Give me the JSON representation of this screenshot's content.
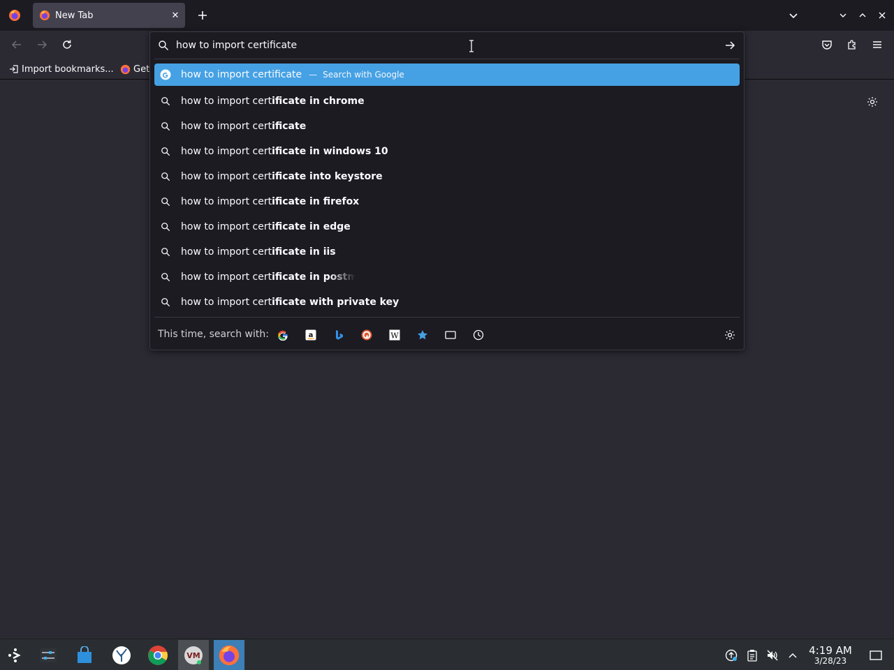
{
  "browser": {
    "tab": {
      "title": "New Tab",
      "close": "✕"
    },
    "new_tab": "+"
  },
  "bookmarks": [
    {
      "label": "Import bookmarks..."
    },
    {
      "label": "Get"
    }
  ],
  "urlbar": {
    "value": "how to import certificate",
    "heuristic": {
      "text": "how to import certificate",
      "dash": "—",
      "action": "Search with Google"
    },
    "suggestions": [
      {
        "typed": "how to import cert",
        "bold": "ificate in chrome"
      },
      {
        "typed": "how to import cert",
        "bold": "ificate"
      },
      {
        "typed": "how to import cert",
        "bold": "ificate in windows 10"
      },
      {
        "typed": "how to import cert",
        "bold": "ificate into keystore"
      },
      {
        "typed": "how to import cert",
        "bold": "ificate in firefox"
      },
      {
        "typed": "how to import cert",
        "bold": "ificate in edge"
      },
      {
        "typed": "how to import cert",
        "bold": "ificate in iis"
      },
      {
        "typed": "how to import cert",
        "bold": "ificate in postman"
      },
      {
        "typed": "how to import cert",
        "bold": "ificate with private key"
      }
    ],
    "oneoff_label": "This time, search with:",
    "engines": [
      "google-icon",
      "amazon-icon",
      "bing-icon",
      "duckduckgo-icon",
      "wikipedia-icon",
      "bookmarks-star-icon",
      "tabs-icon",
      "history-icon"
    ]
  },
  "taskbar": {
    "time": "4:19 AM",
    "date": "3/28/23"
  },
  "colors": {
    "accent": "#45a1e4",
    "panel": "#1c1b22",
    "page": "#2b2a33",
    "taskbar_active": "#3d7fb6"
  }
}
